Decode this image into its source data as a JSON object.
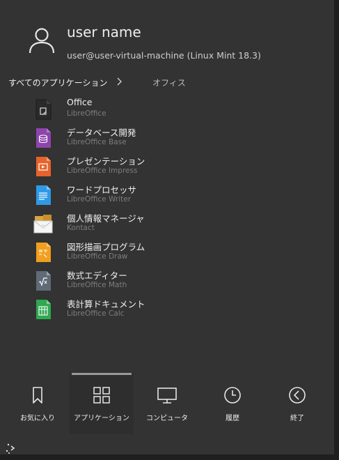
{
  "user": {
    "name": "user name",
    "host": "user@user-virtual-machine (Linux Mint 18.3)"
  },
  "breadcrumb": {
    "all": "すべてのアプリケーション",
    "current": "オフィス"
  },
  "apps": [
    {
      "name": "Office",
      "sub": "LibreOffice",
      "icon": "libreoffice-icon",
      "color": "#2b2b2b"
    },
    {
      "name": "データベース開発",
      "sub": "LibreOffice Base",
      "icon": "libreoffice-base-icon",
      "color": "#8e44ad"
    },
    {
      "name": "プレゼンテーション",
      "sub": "LibreOffice Impress",
      "icon": "libreoffice-impress-icon",
      "color": "#e8632b"
    },
    {
      "name": "ワードプロセッサ",
      "sub": "LibreOffice Writer",
      "icon": "libreoffice-writer-icon",
      "color": "#2e9ae6"
    },
    {
      "name": "個人情報マネージャ",
      "sub": "Kontact",
      "icon": "kontact-icon",
      "color": "#e6b84a"
    },
    {
      "name": "図形描画プログラム",
      "sub": "LibreOffice Draw",
      "icon": "libreoffice-draw-icon",
      "color": "#f0a020"
    },
    {
      "name": "数式エディター",
      "sub": "LibreOffice Math",
      "icon": "libreoffice-math-icon",
      "color": "#5f6b77"
    },
    {
      "name": "表計算ドキュメント",
      "sub": "LibreOffice Calc",
      "icon": "libreoffice-calc-icon",
      "color": "#2fa84f"
    }
  ],
  "tabs": [
    {
      "label": "お気に入り",
      "icon": "bookmark-icon"
    },
    {
      "label": "アプリケーション",
      "icon": "grid-icon",
      "active": true
    },
    {
      "label": "コンピュータ",
      "icon": "monitor-icon"
    },
    {
      "label": "履歴",
      "icon": "clock-icon"
    },
    {
      "label": "終了",
      "icon": "back-circle-icon"
    }
  ]
}
